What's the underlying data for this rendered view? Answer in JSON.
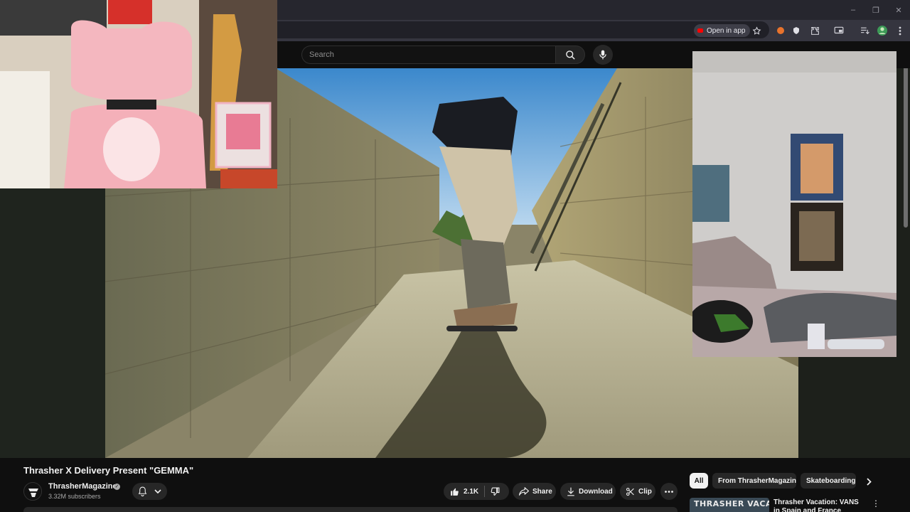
{
  "browser": {
    "open_in_app_label": "Open in app",
    "window_controls": {
      "minimize": "–",
      "restore": "❐",
      "close": "✕"
    }
  },
  "search": {
    "placeholder": "Search"
  },
  "video": {
    "title": "Thrasher X Delivery Present \"GEMMA\""
  },
  "channel": {
    "name": "ThrasherMagazine",
    "subscribers": "3.32M subscribers",
    "verified_mark": "✓"
  },
  "actions": {
    "likes": "2.1K",
    "share": "Share",
    "download": "Download",
    "clip": "Clip"
  },
  "chips": [
    "All",
    "From ThrasherMagazine",
    "Skateboarding tr"
  ],
  "recommendations": [
    {
      "title": "Thrasher Vacation: VANS in Spain and France",
      "thumb_text": "THRASHER VACATION"
    }
  ],
  "icons": [
    "search-icon",
    "mic-icon",
    "bell-icon",
    "chevron-down-icon",
    "like-icon",
    "dislike-icon",
    "share-icon",
    "download-icon",
    "scissors-icon",
    "more-icon",
    "chevron-right-icon",
    "star-icon",
    "extensions-icon"
  ],
  "colors": {
    "background": "#0f0f0f",
    "pill": "#272727",
    "text": "#f1f1f1",
    "muted": "#aaaaaa",
    "youtube_red": "#ff0000"
  }
}
